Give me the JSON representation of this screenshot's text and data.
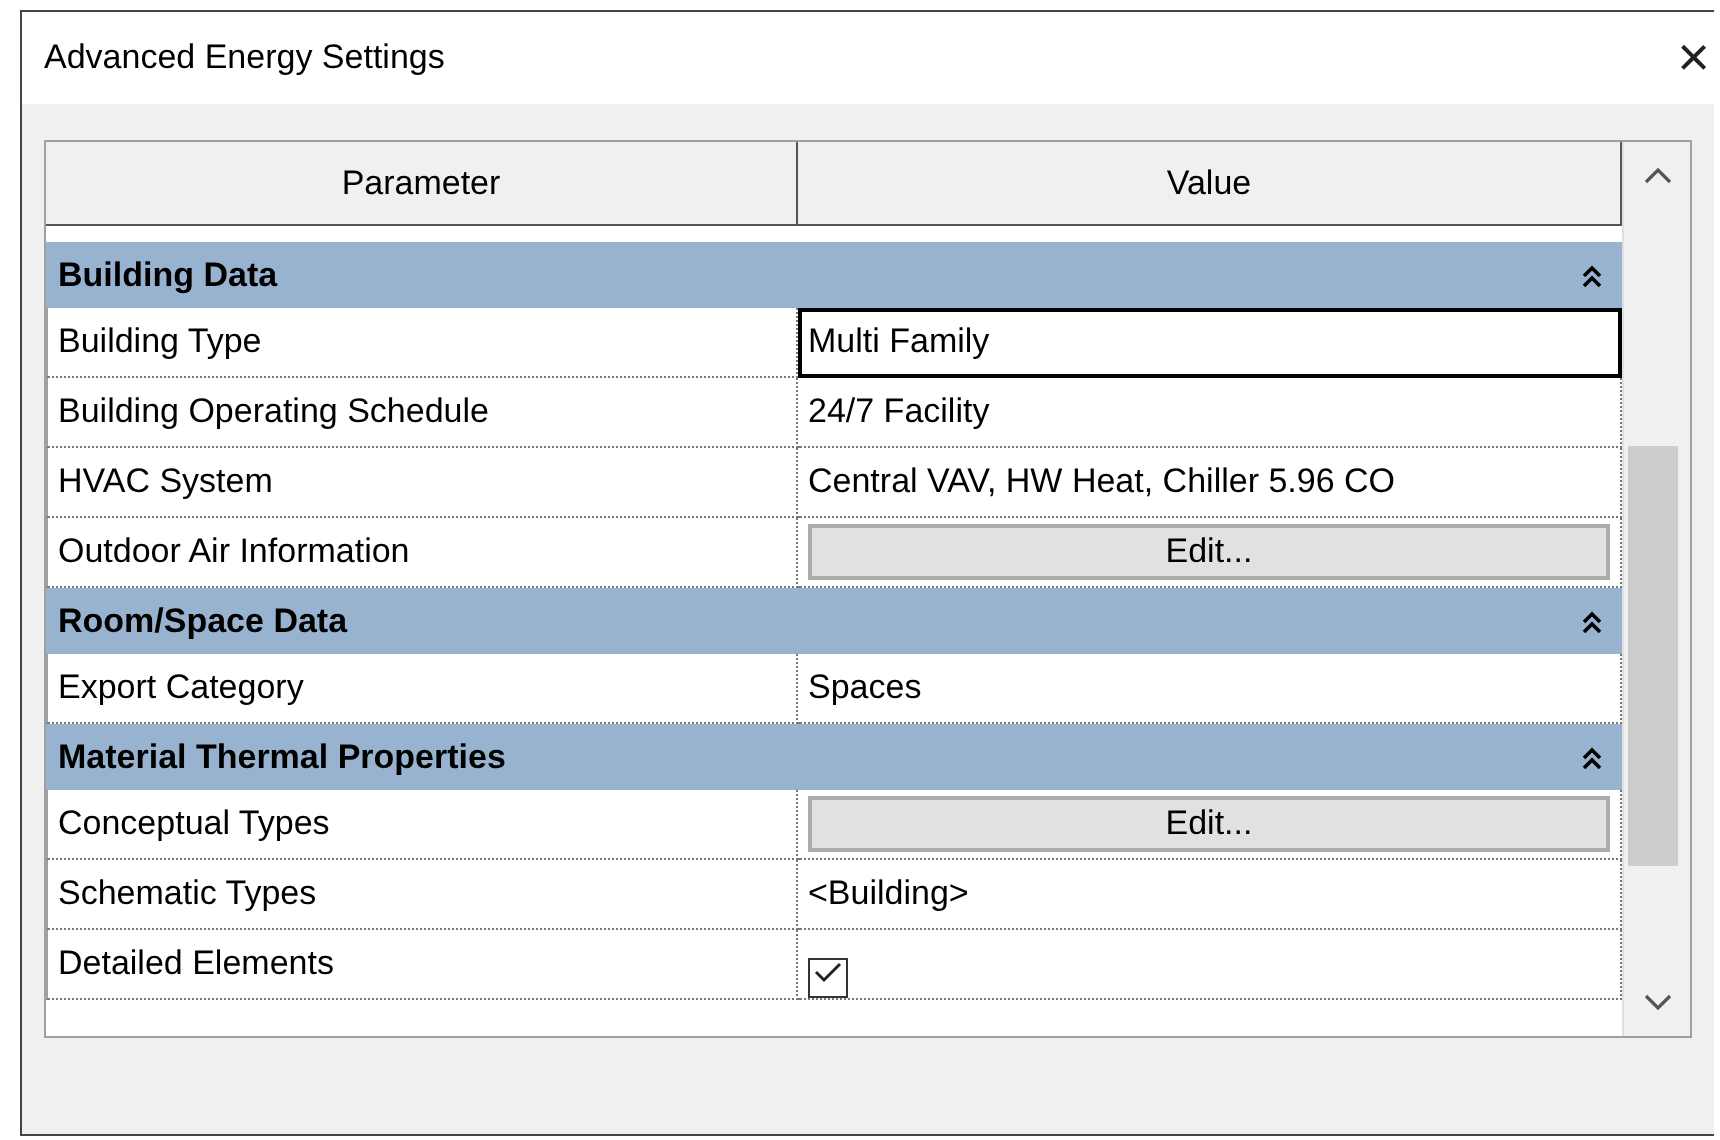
{
  "window": {
    "title": "Advanced Energy Settings",
    "close": "×"
  },
  "table": {
    "columns": [
      "Parameter",
      "Value"
    ],
    "sections": [
      {
        "title": "Building Data",
        "expanded": true,
        "rows": [
          {
            "kind": "text",
            "parameter": "Building Type",
            "value": "Multi Family",
            "selected": true
          },
          {
            "kind": "text",
            "parameter": "Building Operating Schedule",
            "value": "24/7 Facility",
            "selected": false
          },
          {
            "kind": "text",
            "parameter": "HVAC System",
            "value": "Central VAV, HW Heat, Chiller 5.96 CO",
            "selected": false
          },
          {
            "kind": "button",
            "parameter": "Outdoor Air Information",
            "value": "Edit...",
            "selected": false
          }
        ]
      },
      {
        "title": "Room/Space Data",
        "expanded": true,
        "rows": [
          {
            "kind": "text",
            "parameter": "Export Category",
            "value": "Spaces",
            "selected": false
          }
        ]
      },
      {
        "title": "Material Thermal Properties",
        "expanded": true,
        "rows": [
          {
            "kind": "button",
            "parameter": "Conceptual Types",
            "value": "Edit...",
            "selected": false
          },
          {
            "kind": "text",
            "parameter": "Schematic Types",
            "value": "<Building>",
            "selected": false
          },
          {
            "kind": "checkbox",
            "parameter": "Detailed Elements",
            "checked": true,
            "selected": false
          }
        ]
      }
    ]
  }
}
